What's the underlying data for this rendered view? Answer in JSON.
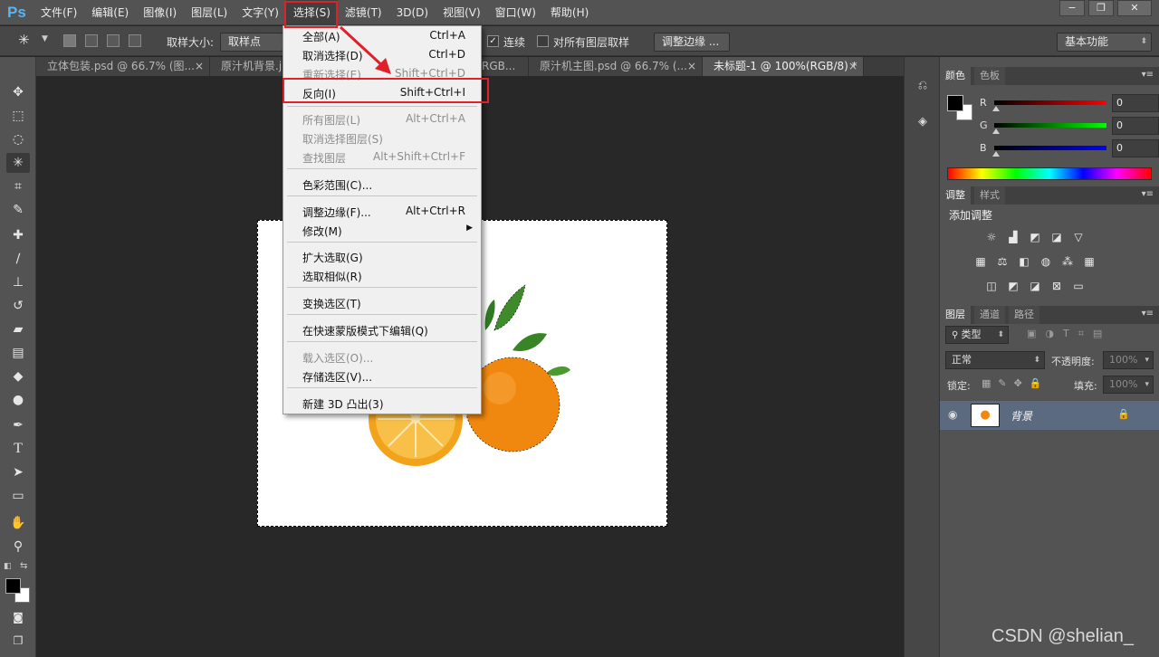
{
  "app": {
    "logo": "Ps"
  },
  "menubar": {
    "items": [
      {
        "label": "文件(F)"
      },
      {
        "label": "编辑(E)"
      },
      {
        "label": "图像(I)"
      },
      {
        "label": "图层(L)"
      },
      {
        "label": "文字(Y)"
      },
      {
        "label": "选择(S)"
      },
      {
        "label": "滤镜(T)"
      },
      {
        "label": "3D(D)"
      },
      {
        "label": "视图(V)"
      },
      {
        "label": "窗口(W)"
      },
      {
        "label": "帮助(H)"
      }
    ],
    "active_index": 5
  },
  "window_controls": {
    "minimize": "−",
    "restore": "❐",
    "close": "✕"
  },
  "options": {
    "sample_size_label": "取样大小:",
    "sample_size_value": "取样点",
    "contiguous_label": "连续",
    "all_layers_label": "对所有图层取样",
    "refine_edge_label": "调整边缘 ...",
    "workspace_value": "基本功能"
  },
  "tabs": [
    {
      "label": "立体包装.psd @ 66.7% (图..."
    },
    {
      "label": "原汁机背景.j"
    },
    {
      "label": "RGB..."
    },
    {
      "label": "原汁机主图.psd @ 66.7% (..."
    },
    {
      "label": "未标题-1 @ 100%(RGB/8) *"
    }
  ],
  "select_menu": {
    "items": [
      {
        "label": "全部(A)",
        "shortcut": "Ctrl+A",
        "disabled": false
      },
      {
        "label": "取消选择(D)",
        "shortcut": "Ctrl+D",
        "disabled": false
      },
      {
        "label": "重新选择(E)",
        "shortcut": "Shift+Ctrl+D",
        "disabled": true
      },
      {
        "label": "反向(I)",
        "shortcut": "Shift+Ctrl+I",
        "disabled": false
      },
      {
        "label": "所有图层(L)",
        "shortcut": "Alt+Ctrl+A",
        "disabled": true
      },
      {
        "label": "取消选择图层(S)",
        "shortcut": "",
        "disabled": true
      },
      {
        "label": "查找图层",
        "shortcut": "Alt+Shift+Ctrl+F",
        "disabled": true
      },
      {
        "label": "色彩范围(C)...",
        "shortcut": "",
        "disabled": false
      },
      {
        "label": "调整边缘(F)...",
        "shortcut": "Alt+Ctrl+R",
        "disabled": false
      },
      {
        "label": "修改(M)",
        "shortcut": "",
        "disabled": false
      },
      {
        "label": "扩大选取(G)",
        "shortcut": "",
        "disabled": false
      },
      {
        "label": "选取相似(R)",
        "shortcut": "",
        "disabled": false
      },
      {
        "label": "变换选区(T)",
        "shortcut": "",
        "disabled": false
      },
      {
        "label": "在快速蒙版模式下编辑(Q)",
        "shortcut": "",
        "disabled": false
      },
      {
        "label": "载入选区(O)...",
        "shortcut": "",
        "disabled": true
      },
      {
        "label": "存储选区(V)...",
        "shortcut": "",
        "disabled": false
      },
      {
        "label": "新建 3D 凸出(3)",
        "shortcut": "",
        "disabled": false
      }
    ]
  },
  "color_panel": {
    "tabs": [
      "颜色",
      "色板"
    ],
    "r_label": "R",
    "g_label": "G",
    "b_label": "B",
    "r_value": "0",
    "g_value": "0",
    "b_value": "0"
  },
  "adjust_panel": {
    "tabs": [
      "调整",
      "样式"
    ],
    "title": "添加调整"
  },
  "layers_panel": {
    "tabs": [
      "图层",
      "通道",
      "路径"
    ],
    "filter_label": "类型",
    "blend_mode": "正常",
    "opacity_label": "不透明度:",
    "opacity_value": "100%",
    "lock_label": "锁定:",
    "fill_label": "填充:",
    "fill_value": "100%",
    "layer_name": "背景"
  },
  "watermark": "CSDN @shelian_",
  "annotation_colors": {
    "highlight": "#e0202a"
  }
}
